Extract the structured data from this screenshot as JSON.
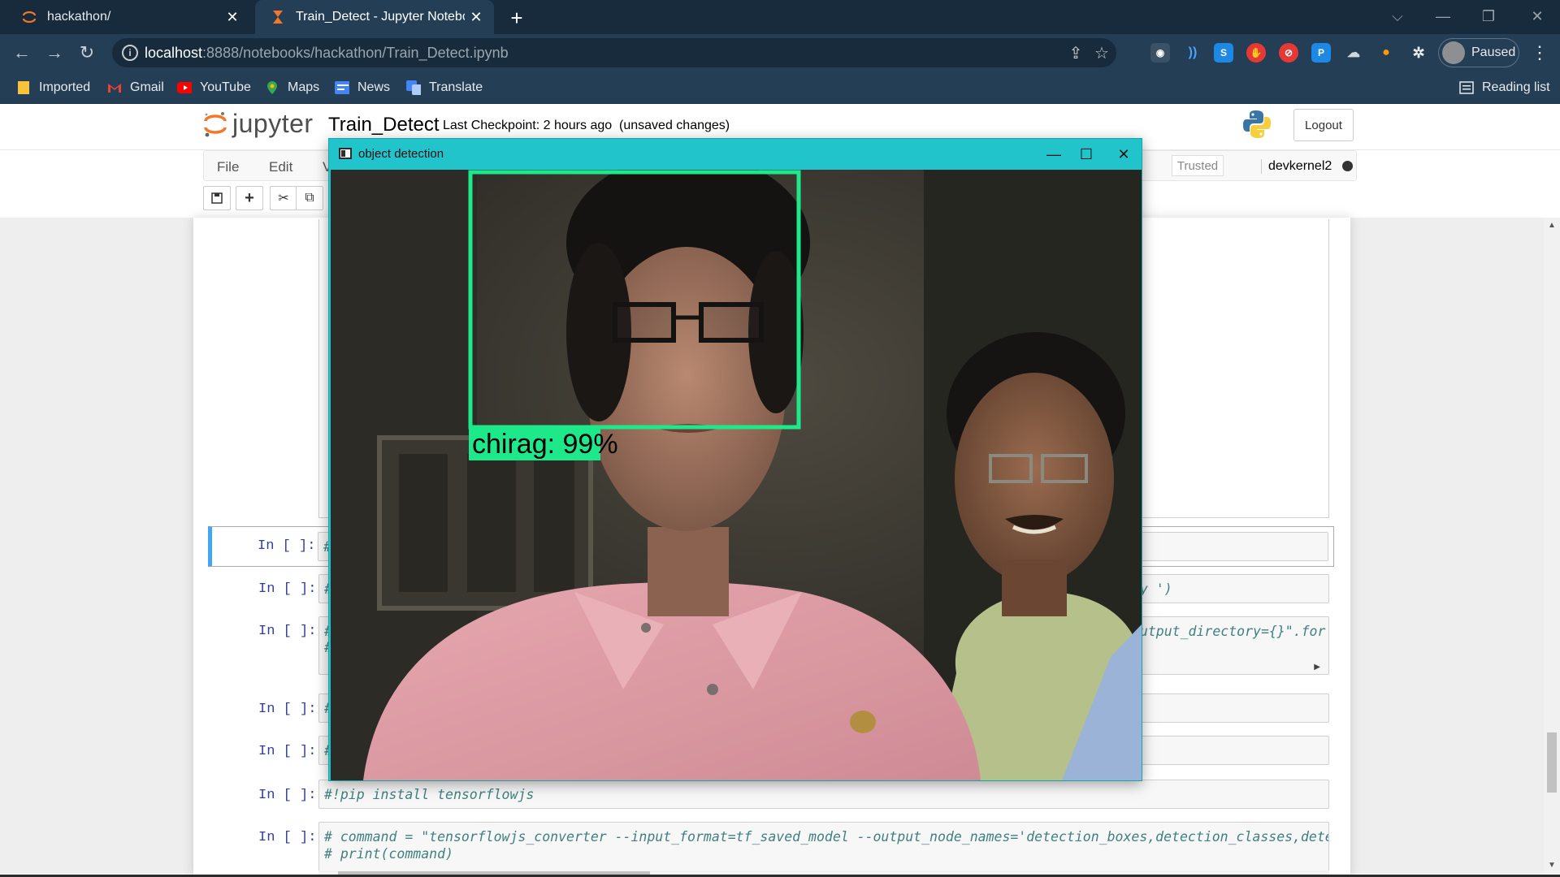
{
  "browser": {
    "tabs": [
      {
        "title": "hackathon/",
        "active": false,
        "icon": "jupyter-icon"
      },
      {
        "title": "Train_Detect - Jupyter Notebook",
        "active": true,
        "icon": "hourglass-icon"
      }
    ],
    "address": {
      "host": "localhost",
      "path": ":8888/notebooks/hackathon/Train_Detect.ipynb"
    },
    "profile_label": "Paused",
    "bookmarks": [
      "Imported",
      "Gmail",
      "YouTube",
      "Maps",
      "News",
      "Translate"
    ],
    "reading_list": "Reading list"
  },
  "jupyter": {
    "logo_text": "jupyter",
    "notebook_name": "Train_Detect",
    "checkpoint": "Last Checkpoint: 2 hours ago",
    "unsaved": "(unsaved changes)",
    "logout": "Logout",
    "menu": [
      "File",
      "Edit",
      "V"
    ],
    "trusted": "Trusted",
    "kernel": "devkernel2",
    "toolbar_icons": [
      "save-icon",
      "add-cell-icon",
      "cut-icon",
      "copy-icon"
    ]
  },
  "cells": [
    {
      "prompt": "In [ ]:",
      "left_code": "#",
      "right_code": ""
    },
    {
      "prompt": "In [ ]:",
      "left_code": "#",
      "right_code": "py ')"
    },
    {
      "prompt": "In [ ]:",
      "left_code": "#",
      "left_code_2": "#",
      "right_code": "output_directory={}\".for"
    },
    {
      "prompt": "In [ ]:",
      "left_code": "#",
      "right_code": ""
    },
    {
      "prompt": "In [ ]:",
      "left_code": "#",
      "right_code": ""
    },
    {
      "prompt": "In [ ]:",
      "left_code": "#!pip install tensorflowjs"
    },
    {
      "prompt": "In [ ]:",
      "left_code": "# command = \"tensorflowjs_converter --input_format=tf_saved_model --output_node_names='detection_boxes,detection_classes,detecti",
      "left_code_2": "# print(command)"
    }
  ],
  "detection_window": {
    "title": "object detection",
    "label": "chirag: 99%",
    "box_color": "#1de98b"
  },
  "colors": {
    "chrome_dark": "#172b3c",
    "chrome": "#243e55",
    "jupyter_orange": "#f37726",
    "prompt_blue": "#303f9f",
    "selected_cell": "#42a5f5",
    "window_title": "#22c4cc"
  }
}
